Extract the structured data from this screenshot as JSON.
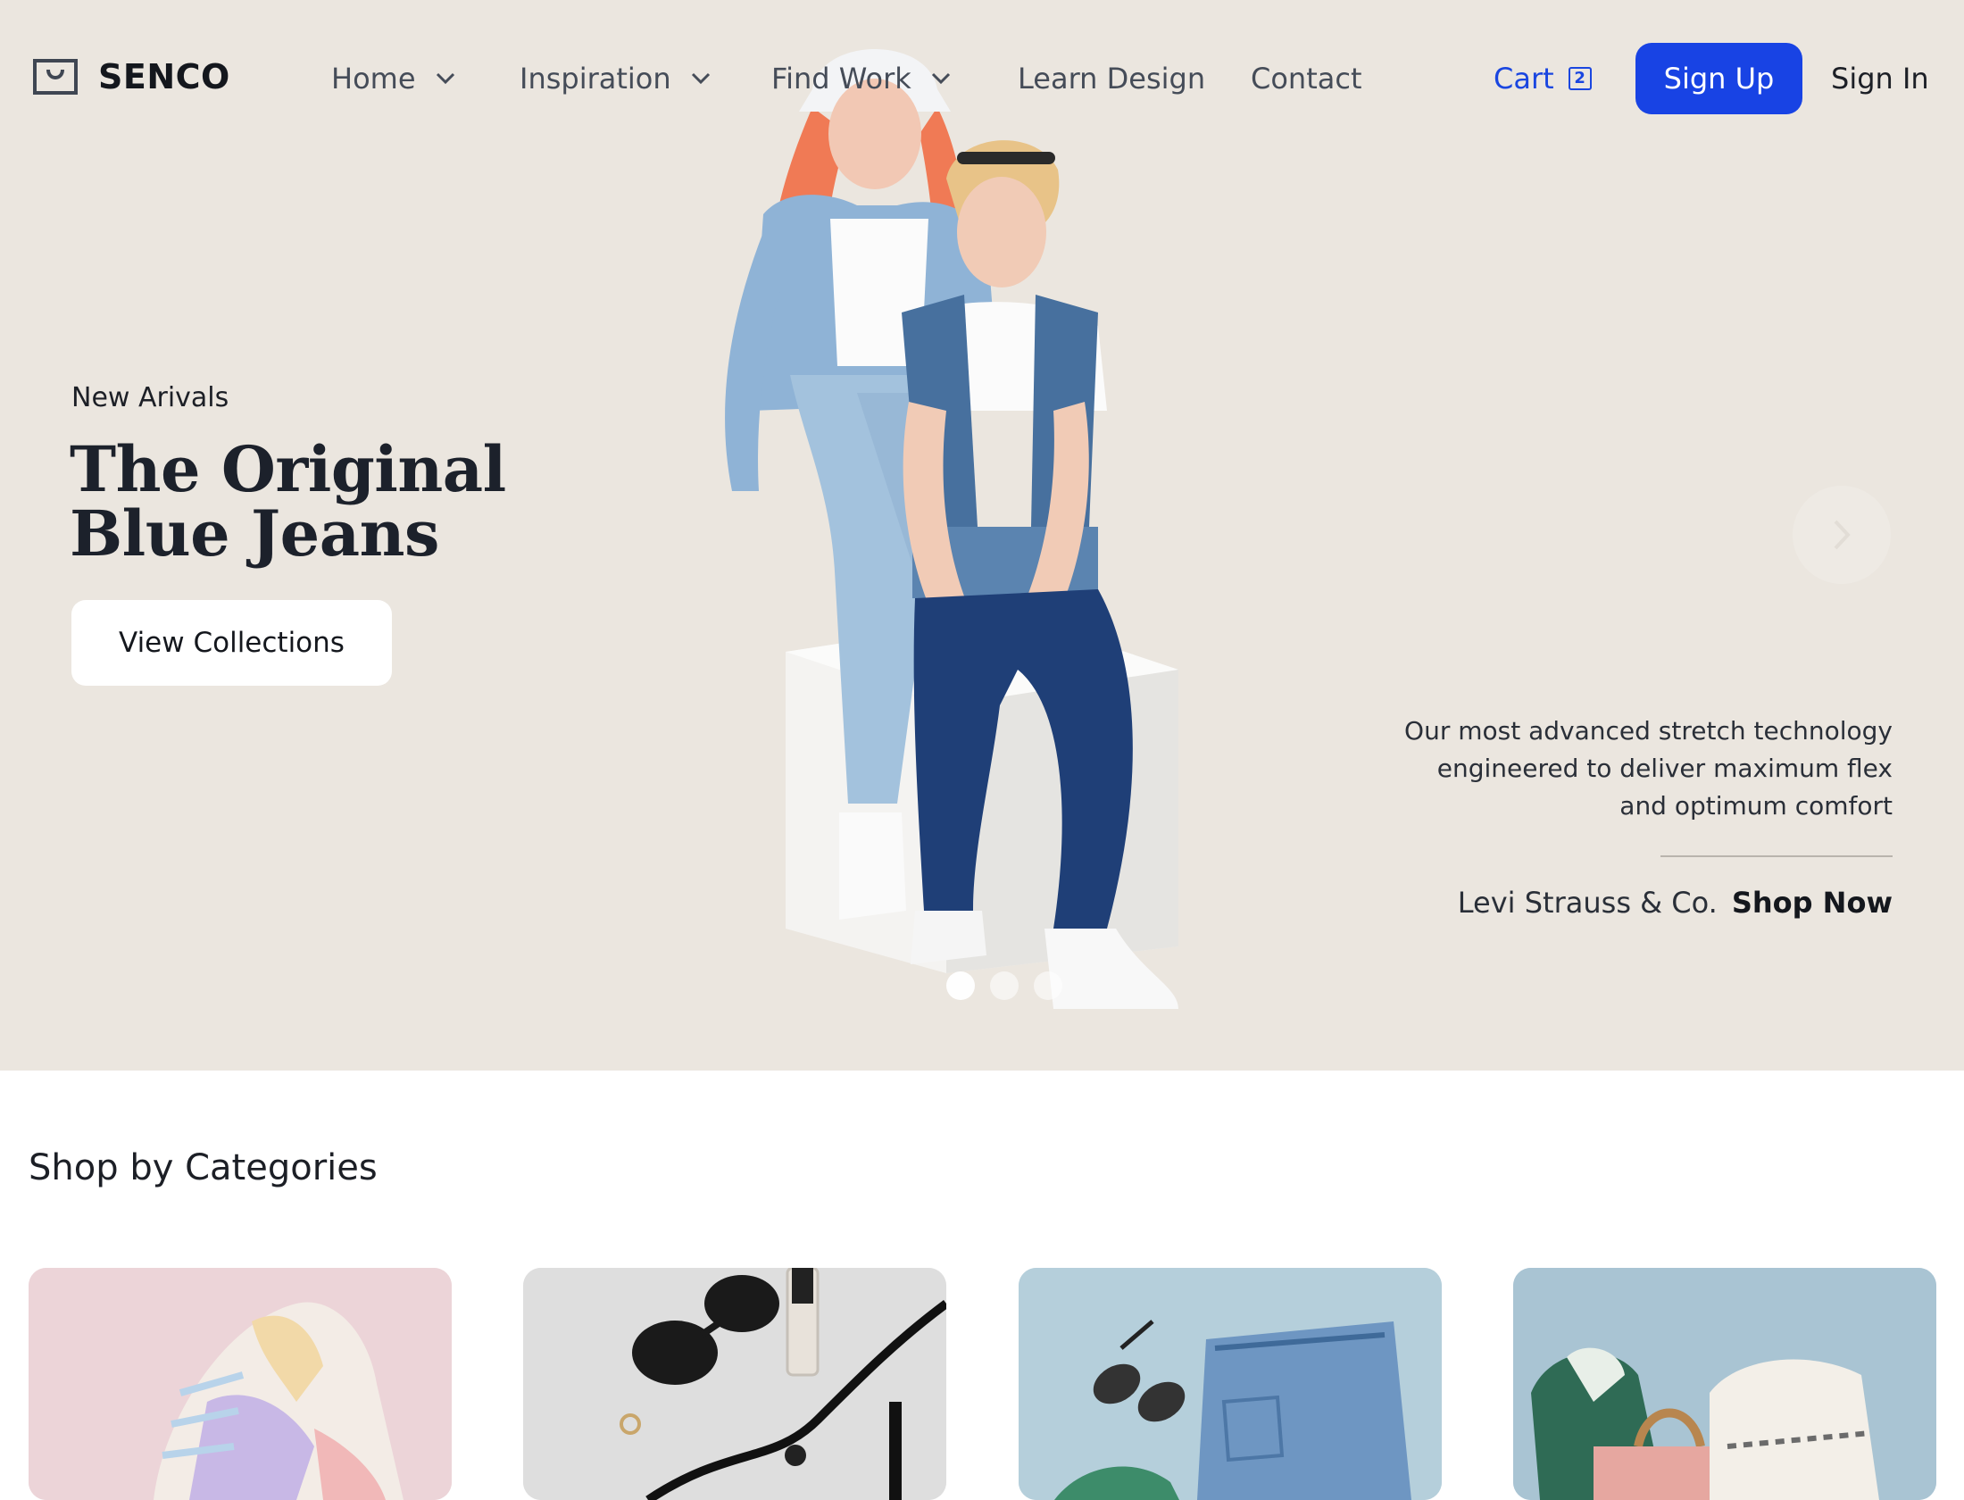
{
  "header": {
    "logo_text": "SENCO",
    "nav": [
      {
        "label": "Home",
        "has_dropdown": true
      },
      {
        "label": "Inspiration",
        "has_dropdown": true
      },
      {
        "label": "Find Work",
        "has_dropdown": true
      },
      {
        "label": "Learn Design",
        "has_dropdown": false
      },
      {
        "label": "Contact",
        "has_dropdown": false
      }
    ],
    "cart_label": "Cart",
    "cart_count": "2",
    "signup_label": "Sign Up",
    "signin_label": "Sign In"
  },
  "hero": {
    "eyebrow": "New Arivals",
    "title": "The Original Blue Jeans",
    "cta_label": "View Collections",
    "description": "Our most advanced stretch technology engineered to deliver maximum flex and optimum comfort",
    "brand": "Levi Strauss & Co.",
    "shop_label": "Shop Now",
    "slides": 3,
    "active_slide": 1
  },
  "categories": {
    "title": "Shop by Categories",
    "items": [
      {
        "icon": "sneakers-image",
        "bg": "#ecd4d8"
      },
      {
        "icon": "accessories-image",
        "bg": "#dcdcdc"
      },
      {
        "icon": "denim-image",
        "bg": "#b5cfdb"
      },
      {
        "icon": "bags-image",
        "bg": "#a9c4d3"
      }
    ]
  },
  "colors": {
    "hero_bg": "#ebe6df",
    "accent": "#1843e4",
    "text": "#1c1f26"
  }
}
